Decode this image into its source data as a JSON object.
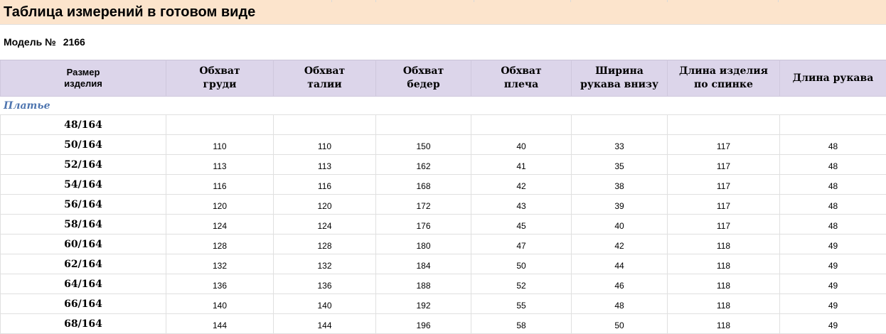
{
  "title": "Таблица измерений в готовом виде",
  "model": {
    "label": "Модель №",
    "number": "2166"
  },
  "columns": [
    {
      "line1": "Размер",
      "line2": "изделия"
    },
    {
      "line1": "Обхват",
      "line2": "груди"
    },
    {
      "line1": "Обхват",
      "line2": "талии"
    },
    {
      "line1": "Обхват",
      "line2": "бедер"
    },
    {
      "line1": "Обхват",
      "line2": "плеча"
    },
    {
      "line1": "Ширина",
      "line2": "рукава внизу"
    },
    {
      "line1": "Длина изделия",
      "line2": "по спинке"
    },
    {
      "line1": "Длина рукава",
      "line2": ""
    }
  ],
  "section": "Платье",
  "rows": [
    {
      "size": "48/164",
      "values": [
        "",
        "",
        "",
        "",
        "",
        "",
        ""
      ]
    },
    {
      "size": "50/164",
      "values": [
        "110",
        "110",
        "150",
        "40",
        "33",
        "117",
        "48"
      ]
    },
    {
      "size": "52/164",
      "values": [
        "113",
        "113",
        "162",
        "41",
        "35",
        "117",
        "48"
      ]
    },
    {
      "size": "54/164",
      "values": [
        "116",
        "116",
        "168",
        "42",
        "38",
        "117",
        "48"
      ]
    },
    {
      "size": "56/164",
      "values": [
        "120",
        "120",
        "172",
        "43",
        "39",
        "117",
        "48"
      ]
    },
    {
      "size": "58/164",
      "values": [
        "124",
        "124",
        "176",
        "45",
        "40",
        "117",
        "48"
      ]
    },
    {
      "size": "60/164",
      "values": [
        "128",
        "128",
        "180",
        "47",
        "42",
        "118",
        "49"
      ]
    },
    {
      "size": "62/164",
      "values": [
        "132",
        "132",
        "184",
        "50",
        "44",
        "118",
        "49"
      ]
    },
    {
      "size": "64/164",
      "values": [
        "136",
        "136",
        "188",
        "52",
        "46",
        "118",
        "49"
      ]
    },
    {
      "size": "66/164",
      "values": [
        "140",
        "140",
        "192",
        "55",
        "48",
        "118",
        "49"
      ]
    },
    {
      "size": "68/164",
      "values": [
        "144",
        "144",
        "196",
        "58",
        "50",
        "118",
        "49"
      ]
    }
  ],
  "colors": {
    "title_bg": "#fce4cc",
    "header_bg": "#dcd5ea",
    "section_text": "#4f76b0"
  }
}
